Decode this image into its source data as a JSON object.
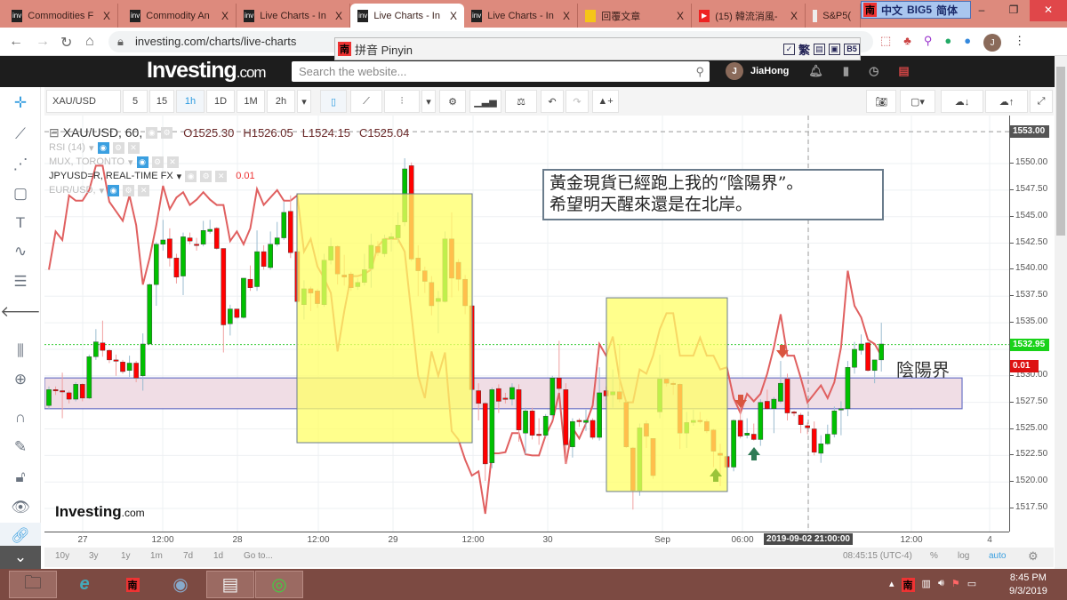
{
  "browser": {
    "tabs": [
      {
        "title": "Commodities F",
        "icon": "investing-favicon"
      },
      {
        "title": "Commodity An",
        "icon": "investing-favicon"
      },
      {
        "title": "Live Charts - In",
        "icon": "investing-favicon"
      },
      {
        "title": "Live Charts - In",
        "icon": "investing-favicon",
        "active": true
      },
      {
        "title": "Live Charts - In",
        "icon": "investing-favicon"
      },
      {
        "title": "回覆文章",
        "icon": "lightbulb-favicon"
      },
      {
        "title": "(15) 韓流消風-",
        "icon": "youtube-favicon"
      },
      {
        "title": "S&P5(",
        "icon": "chart-favicon"
      }
    ],
    "tab_close": "X",
    "url": "investing.com/charts/live-charts",
    "ime_bar": {
      "badge": "南",
      "label1": "中文",
      "label2": "BIG5",
      "label3": "简体"
    },
    "pinyin_bar": {
      "badge": "南",
      "label": "拼音 Pinyin",
      "trad": "繁",
      "b5": "B5"
    },
    "profile_initial": "J"
  },
  "site": {
    "logo": "Investing",
    "logo_suffix": ".com",
    "search_placeholder": "Search the website...",
    "user_initial": "J",
    "user_name": "JiaHong"
  },
  "toolbar": {
    "symbol": "XAU/USD",
    "intervals": [
      "5",
      "15",
      "1h",
      "1D",
      "1M",
      "2h"
    ],
    "selected_interval": "1h"
  },
  "legend": {
    "title": "XAU/USD, 60,",
    "open": "O1525.30",
    "high": "H1526.05",
    "low": "L1524.15",
    "close": "C1525.04",
    "indicators": [
      {
        "name": "RSI (14)",
        "visible": true
      },
      {
        "name": "MUX, TORONTO",
        "visible": true
      },
      {
        "name": "JPYUSD=R, REAL-TIME FX",
        "visible": false,
        "value": "0.01"
      },
      {
        "name": "EUR/USD,",
        "visible": true
      }
    ]
  },
  "annotation": {
    "line1": "黃金現貨已經跑上我的“陰陽界”。",
    "line2": "希望明天醒來還是在北岸。",
    "band_label": "陰陽界"
  },
  "watermark": {
    "logo": "Investing",
    "suffix": ".com"
  },
  "bottom": {
    "ranges": [
      "10y",
      "3y",
      "1y",
      "1m",
      "7d",
      "1d",
      "Go to..."
    ],
    "time": "08:45:15 (UTC-4)",
    "percent": "%",
    "log": "log",
    "auto": "auto"
  },
  "taskbar": {
    "apps": [
      "file-explorer",
      "internet-explorer",
      "nan-ime",
      "chrome-alt",
      "notepad",
      "chrome"
    ],
    "time": "8:45 PM",
    "date": "9/3/2019"
  },
  "chart_data": {
    "type": "candlestick",
    "symbol": "XAU/USD",
    "interval": "60",
    "colors": {
      "up": "#00c000",
      "down": "#ff0000",
      "overlay": "#e06060",
      "highlight": "#ffff66",
      "band": "#f0dde5",
      "band_border": "#6b73c6"
    },
    "y_ticks": [
      "1517.50",
      "1520.00",
      "1522.50",
      "1525.00",
      "1527.50",
      "1530.00",
      "1532.50",
      "1535.00",
      "1537.50",
      "1540.00",
      "1542.50",
      "1545.00",
      "1547.50",
      "1550.00"
    ],
    "ylim": [
      1515.5,
      1554
    ],
    "crosshair_price": "1553.00",
    "last_price": "1532.95",
    "overlay_value": "0.01",
    "x_tick_labels": [
      "27",
      "12:00",
      "28",
      "12:00",
      "29",
      "12:00",
      "30",
      "Sep",
      "06:00",
      "2019-09-02 21:00:00",
      "12:00",
      "4"
    ],
    "candles_ohlc": [
      [
        1527.2,
        1529.0,
        1526.9,
        1528.7
      ],
      [
        1528.7,
        1529.0,
        1528.2,
        1528.6
      ],
      [
        1528.6,
        1530.3,
        1526.0,
        1528.5
      ],
      [
        1528.4,
        1528.6,
        1527.4,
        1527.8
      ],
      [
        1527.8,
        1529.4,
        1527.6,
        1529.2
      ],
      [
        1529.2,
        1529.3,
        1527.6,
        1527.9
      ],
      [
        1527.9,
        1532.0,
        1527.8,
        1531.8
      ],
      [
        1531.8,
        1534.4,
        1531.5,
        1533.2
      ],
      [
        1533.1,
        1535.2,
        1531.8,
        1532.4
      ],
      [
        1532.4,
        1532.5,
        1531.2,
        1531.5
      ],
      [
        1531.5,
        1532.0,
        1530.0,
        1531.4
      ],
      [
        1531.3,
        1531.5,
        1530.2,
        1530.4
      ],
      [
        1530.5,
        1531.9,
        1529.9,
        1531.2
      ],
      [
        1531.2,
        1531.4,
        1529.4,
        1529.8
      ],
      [
        1530.0,
        1534.0,
        1528.6,
        1533.0
      ],
      [
        1533.0,
        1538.7,
        1533.0,
        1538.6
      ],
      [
        1538.6,
        1542.6,
        1536.6,
        1542.4
      ],
      [
        1542.4,
        1544.7,
        1541.8,
        1542.8
      ],
      [
        1542.9,
        1543.9,
        1540.3,
        1541.1
      ],
      [
        1541.1,
        1541.5,
        1538.7,
        1539.3
      ],
      [
        1539.4,
        1543.5,
        1537.6,
        1543.1
      ],
      [
        1543.0,
        1543.5,
        1542.4,
        1542.7
      ],
      [
        1542.4,
        1543.0,
        1541.8,
        1542.3
      ],
      [
        1542.4,
        1544.6,
        1542.2,
        1543.7
      ],
      [
        1543.6,
        1544.7,
        1543.4,
        1543.8
      ],
      [
        1543.9,
        1544.0,
        1541.9,
        1542.0
      ],
      [
        1542.0,
        1542.0,
        1532.2,
        1534.8
      ],
      [
        1534.9,
        1536.7,
        1533.8,
        1536.3
      ],
      [
        1536.3,
        1536.3,
        1535.4,
        1535.5
      ],
      [
        1535.5,
        1539.2,
        1535.4,
        1539.2
      ],
      [
        1539.1,
        1540.4,
        1538.0,
        1538.3
      ],
      [
        1538.4,
        1543.7,
        1538.0,
        1541.7
      ],
      [
        1541.7,
        1542.3,
        1540.0,
        1540.3
      ],
      [
        1540.2,
        1543.6,
        1540.0,
        1542.4
      ],
      [
        1542.4,
        1544.5,
        1542.2,
        1543.0
      ],
      [
        1543.0,
        1546.4,
        1542.8,
        1545.4
      ],
      [
        1545.5,
        1547.0,
        1541.1,
        1541.6
      ],
      [
        1541.7,
        1542.0,
        1536.9,
        1537.0
      ],
      [
        1536.7,
        1539.0,
        1535.3,
        1538.2
      ],
      [
        1538.2,
        1538.4,
        1536.1,
        1537.8
      ],
      [
        1538.0,
        1538.2,
        1536.4,
        1536.8
      ],
      [
        1536.7,
        1541.5,
        1536.5,
        1540.9
      ],
      [
        1540.9,
        1543.0,
        1540.5,
        1542.2
      ],
      [
        1542.2,
        1542.3,
        1538.6,
        1539.6
      ],
      [
        1539.5,
        1541.4,
        1538.5,
        1539.3
      ],
      [
        1539.6,
        1539.8,
        1538.0,
        1538.3
      ],
      [
        1538.4,
        1539.2,
        1538.1,
        1538.8
      ],
      [
        1538.8,
        1541.5,
        1538.5,
        1540.0
      ],
      [
        1540.1,
        1543.4,
        1538.3,
        1542.3
      ],
      [
        1542.2,
        1542.7,
        1541.3,
        1541.6
      ],
      [
        1541.5,
        1543.3,
        1541.2,
        1542.9
      ],
      [
        1542.9,
        1543.5,
        1541.7,
        1543.1
      ],
      [
        1543.0,
        1545.4,
        1542.5,
        1544.2
      ],
      [
        1544.5,
        1550.5,
        1544.1,
        1549.5
      ],
      [
        1549.8,
        1550.1,
        1540.8,
        1541.0
      ],
      [
        1541.1,
        1542.3,
        1537.5,
        1539.9
      ],
      [
        1539.9,
        1540.3,
        1537.8,
        1538.9
      ],
      [
        1538.8,
        1539.4,
        1535.7,
        1536.6
      ],
      [
        1537.0,
        1538.0,
        1534.0,
        1537.3
      ],
      [
        1537.0,
        1543.6,
        1536.9,
        1542.9
      ],
      [
        1542.9,
        1545.4,
        1537.4,
        1539.2
      ],
      [
        1540.7,
        1541.0,
        1538.0,
        1539.1
      ],
      [
        1539.1,
        1539.5,
        1535.8,
        1536.6
      ],
      [
        1536.6,
        1536.7,
        1528.6,
        1528.7
      ],
      [
        1528.6,
        1529.3,
        1525.8,
        1527.4
      ],
      [
        1527.4,
        1527.5,
        1520.1,
        1521.7
      ],
      [
        1521.8,
        1528.9,
        1521.3,
        1528.7
      ],
      [
        1528.8,
        1529.2,
        1526.5,
        1527.6
      ],
      [
        1527.9,
        1528.4,
        1527.4,
        1527.8
      ],
      [
        1527.8,
        1529.3,
        1527.2,
        1528.9
      ],
      [
        1528.7,
        1529.2,
        1523.8,
        1524.9
      ],
      [
        1524.6,
        1527.0,
        1522.6,
        1526.7
      ],
      [
        1526.7,
        1527.0,
        1524.0,
        1524.4
      ],
      [
        1524.5,
        1526.0,
        1523.5,
        1524.4
      ],
      [
        1524.4,
        1526.4,
        1524.2,
        1526.2
      ],
      [
        1526.3,
        1530.0,
        1525.9,
        1529.8
      ],
      [
        1529.8,
        1533.3,
        1528.5,
        1528.8
      ],
      [
        1528.7,
        1529.3,
        1521.7,
        1523.5
      ],
      [
        1523.3,
        1526.0,
        1522.3,
        1525.7
      ],
      [
        1525.8,
        1526.0,
        1525.2,
        1525.7
      ],
      [
        1525.6,
        1526.8,
        1524.8,
        1525.8
      ],
      [
        1525.8,
        1526.0,
        1524.0,
        1524.2
      ],
      [
        1524.2,
        1530.8,
        1523.9,
        1528.4
      ],
      [
        1528.6,
        1529.0,
        1527.7,
        1528.1
      ],
      [
        1528.2,
        1530.6,
        1527.0,
        1528.5
      ],
      [
        1528.5,
        1533.0,
        1527.5,
        1527.8
      ],
      [
        1527.5,
        1527.6,
        1523.2,
        1523.3
      ],
      [
        1523.2,
        1523.3,
        1517.4,
        1519.2
      ],
      [
        1519.2,
        1525.5,
        1518.7,
        1525.1
      ],
      [
        1525.5,
        1525.8,
        1523.2,
        1524.3
      ],
      [
        1524.1,
        1524.1,
        1520.3,
        1520.6
      ],
      [
        1526.6,
        1532.0,
        1526.0,
        1529.7
      ],
      [
        1529.7,
        1529.8,
        1529.0,
        1529.3
      ],
      [
        1529.3,
        1529.5,
        1528.2,
        1529.2
      ],
      [
        1529.2,
        1529.3,
        1523.1,
        1524.6
      ],
      [
        1524.6,
        1526.6,
        1523.2,
        1525.6
      ],
      [
        1525.6,
        1526.8,
        1525.3,
        1525.8
      ],
      [
        1525.8,
        1526.6,
        1525.5,
        1525.7
      ],
      [
        1525.7,
        1525.9,
        1524.6,
        1524.8
      ],
      [
        1524.9,
        1525.0,
        1521.4,
        1522.9
      ],
      [
        1522.7,
        1523.6,
        1519.6,
        1522.5
      ],
      [
        1522.4,
        1522.5,
        1521.3,
        1521.4
      ],
      [
        1521.4,
        1525.9,
        1521.0,
        1525.8
      ],
      [
        1525.8,
        1527.3,
        1524.1,
        1524.3
      ],
      [
        1524.4,
        1526.0,
        1524.1,
        1524.6
      ],
      [
        1524.5,
        1525.5,
        1523.9,
        1524.0
      ],
      [
        1524.0,
        1527.8,
        1523.4,
        1527.5
      ],
      [
        1527.6,
        1528.7,
        1526.8,
        1526.9
      ],
      [
        1526.9,
        1528.0,
        1524.6,
        1527.8
      ],
      [
        1527.6,
        1531.4,
        1527.4,
        1529.3
      ],
      [
        1529.7,
        1530.2,
        1525.8,
        1526.5
      ],
      [
        1526.6,
        1526.7,
        1526.2,
        1526.5
      ],
      [
        1526.3,
        1526.5,
        1524.6,
        1525.4
      ],
      [
        1525.3,
        1525.6,
        1524.5,
        1525.1
      ],
      [
        1525.0,
        1525.7,
        1522.5,
        1522.8
      ],
      [
        1522.7,
        1524.4,
        1521.8,
        1523.6
      ],
      [
        1523.6,
        1525.4,
        1523.5,
        1524.5
      ],
      [
        1524.5,
        1527.1,
        1524.2,
        1526.7
      ],
      [
        1526.8,
        1527.6,
        1524.4,
        1526.9
      ],
      [
        1526.9,
        1531.4,
        1526.2,
        1530.8
      ],
      [
        1530.8,
        1533.2,
        1530.2,
        1532.5
      ],
      [
        1532.4,
        1533.9,
        1532.0,
        1533.0
      ],
      [
        1533.1,
        1533.2,
        1530.4,
        1530.5
      ],
      [
        1530.5,
        1531.5,
        1529.3,
        1531.5
      ],
      [
        1531.5,
        1535.0,
        1530.4,
        1533.0
      ]
    ],
    "overlay_series": {
      "name": "JPYUSD=R, REAL-TIME FX",
      "values": [
        1540.0,
        1543.6,
        1542.8,
        1547.0,
        1546.5,
        1546.5,
        1547.5,
        1549.8,
        1549.8,
        1546.4,
        1545.5,
        1544.6,
        1547.0,
        1544.2,
        1538.6,
        1541.1,
        1544.2,
        1547.9,
        1545.7,
        1546.8,
        1547.3,
        1546.1,
        1546.6,
        1547.3,
        1546.6,
        1546.1,
        1546.1,
        1542.7,
        1543.6,
        1542.4,
        1543.9,
        1547.6,
        1546.1,
        1546.8,
        1547.5,
        1546.5,
        1546.5,
        1547.0,
        1541.7,
        1542.9,
        1540.3,
        1539.2,
        1537.8,
        1532.3,
        1536.1,
        1539.4,
        1539.4,
        1539.6,
        1540.0,
        1542.2,
        1542.9,
        1542.9,
        1542.9,
        1541.7,
        1535.8,
        1530.0,
        1527.9,
        1532.3,
        1530.0,
        1532.2,
        1524.8,
        1524.0,
        1522.1,
        1520.6,
        1521.0,
        1517.0,
        1522.7,
        1522.7,
        1522.8,
        1524.6,
        1524.6,
        1522.6,
        1522.5,
        1522.5,
        1524.4,
        1525.7,
        1528.4,
        1521.7,
        1525.1,
        1524.1,
        1525.5,
        1527.2,
        1533.0,
        1531.9,
        1533.7,
        1529.7,
        1527.5,
        1527.5,
        1530.6,
        1530.2,
        1531.9,
        1534.4,
        1535.9,
        1535.9,
        1531.9,
        1531.9,
        1531.9,
        1533.6,
        1531.9,
        1531.9,
        1530.6,
        1530.8,
        1527.9,
        1526.5,
        1528.3,
        1527.6,
        1528.3,
        1530.2,
        1532.7,
        1535.8,
        1531.9,
        1531.9,
        1529.8,
        1527.5,
        1528.3,
        1529.1,
        1527.9,
        1529.4,
        1532.7,
        1539.9,
        1536.6,
        1535.5,
        1533.4,
        1533.0,
        1531.9
      ]
    }
  }
}
